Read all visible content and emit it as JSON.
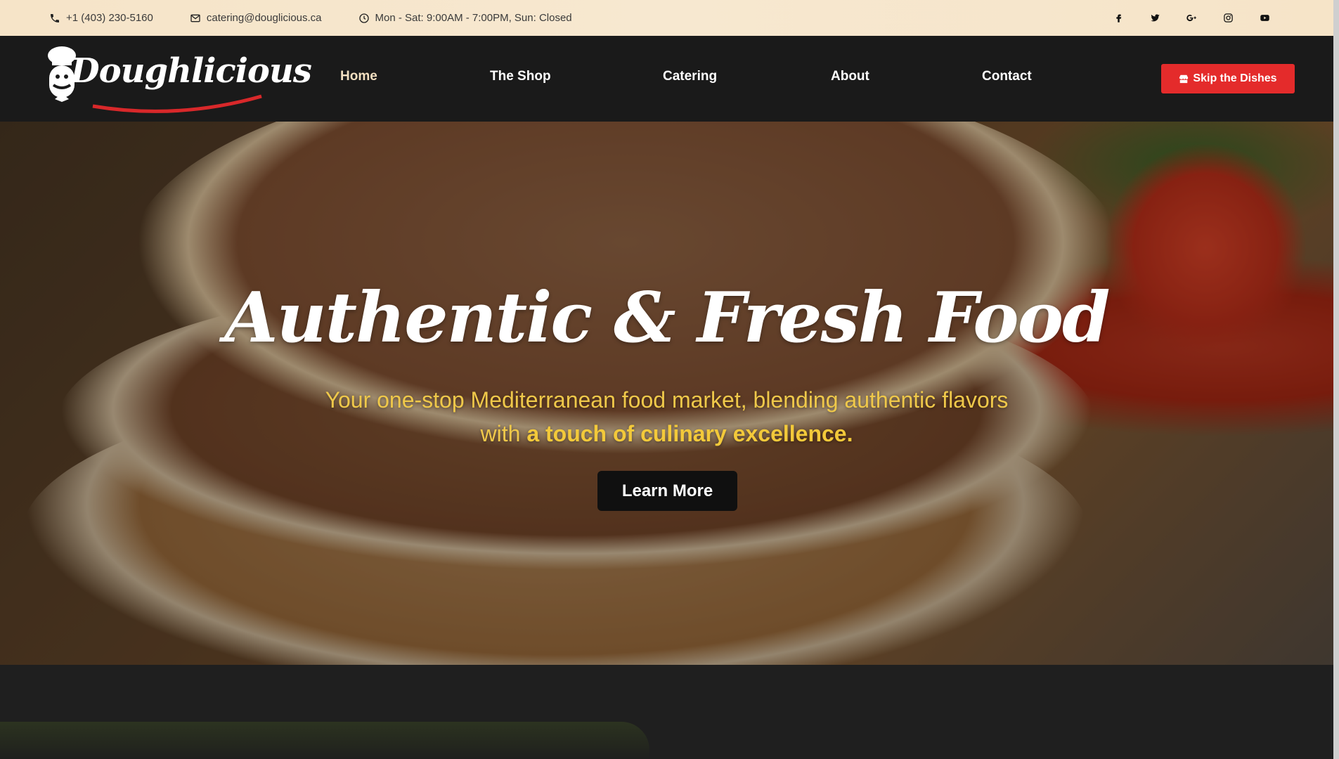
{
  "topbar": {
    "phone": "+1 (403) 230-5160",
    "email": "catering@douglicious.ca",
    "hours": "Mon - Sat: 9:00AM - 7:00PM, Sun: Closed",
    "socials": [
      "facebook-icon",
      "twitter-icon",
      "google-plus-icon",
      "instagram-icon",
      "youtube-icon"
    ]
  },
  "nav": {
    "logo": "Doughlicious",
    "links": [
      "Home",
      "The Shop",
      "Catering",
      "About",
      "Contact"
    ],
    "active": "Home",
    "cta": "Skip the Dishes"
  },
  "hero": {
    "title": "Authentic & Fresh Food",
    "subtitle_plain": "Your one-stop Mediterranean food market, blending authentic flavors with ",
    "subtitle_bold": "a touch of culinary excellence.",
    "button": "Learn More"
  },
  "colors": {
    "topbar_bg": "#f6e4c8",
    "nav_bg": "#1a1a1a",
    "cta_red": "#e42b2b",
    "subtitle_yellow": "#efc84a"
  }
}
